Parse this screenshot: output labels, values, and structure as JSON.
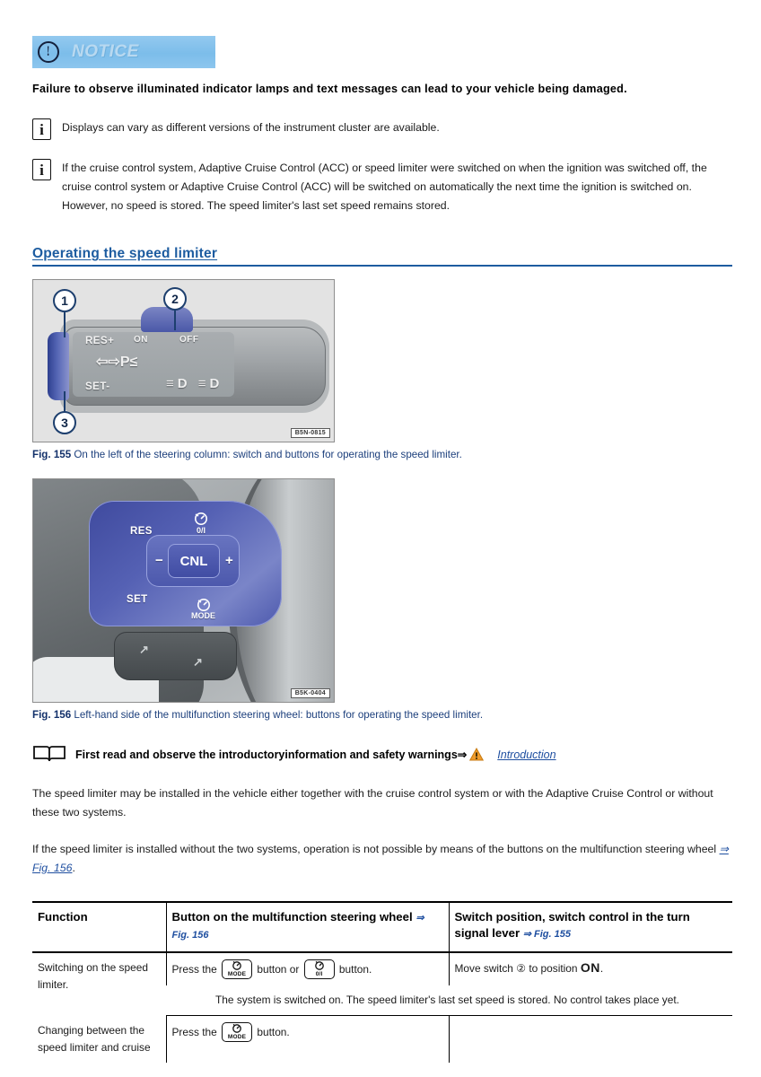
{
  "notice": {
    "icon": "exclamation-circle-icon",
    "label": "NOTICE",
    "text": "Failure to observe illuminated indicator lamps and text messages can lead to your vehicle being damaged."
  },
  "notes": [
    {
      "icon": "info-icon",
      "text": "Displays can vary as different versions of the instrument cluster are available."
    },
    {
      "icon": "info-icon",
      "text": "If the cruise control system, Adaptive Cruise Control (ACC) or speed limiter were switched on when the ignition was switched off, the cruise control system or Adaptive Cruise Control (ACC) will be switched on automatically the next time the ignition is switched on. However, no speed is stored. The speed limiter's last set speed remains stored."
    }
  ],
  "section": {
    "heading": "Operating the speed limiter"
  },
  "figures": [
    {
      "id": "fig-155",
      "code": "B5N-0815",
      "caption_label": "Fig. 155",
      "caption_text": "On the left of the steering column: switch and buttons for operating the speed limiter.",
      "callouts": [
        "1",
        "2",
        "3"
      ],
      "labels": {
        "res": "RES+",
        "on": "ON",
        "off": "OFF",
        "set": "SET-",
        "indicators": "⇦⇨P≤",
        "lamps": "≡D ≡D"
      }
    },
    {
      "id": "fig-156",
      "code": "B5K-0404",
      "caption_label": "Fig. 156",
      "caption_text": "Left-hand side of the multifunction steering wheel: buttons for operating the speed limiter.",
      "labels": {
        "res": "RES",
        "set": "SET",
        "cnl": "CNL",
        "minus": "−",
        "plus": "+",
        "on_off": "0/I",
        "mode": "MODE",
        "lower_left": "↗",
        "lower_right": "↗"
      }
    }
  ],
  "intro": {
    "icon": "open-book-icon",
    "bold_text": "First read and observe the introductoryinformation and safety warnings",
    "arrow": "⇒",
    "warning_icon": "warning-triangle-icon",
    "link": "Introduction"
  },
  "paragraphs": [
    {
      "text": "The speed limiter may be installed in the vehicle either together with the cruise control system or with the Adaptive Cruise Control or without these two systems."
    },
    {
      "text": "If the speed limiter is installed without the two systems, operation is not possible by means of the buttons on the multifunction steering wheel ",
      "xref": "⇒ Fig. 156",
      "tail": "."
    }
  ],
  "table": {
    "headers": [
      {
        "text": "Function",
        "ref": ""
      },
      {
        "text": "Button on the multifunction steering wheel",
        "ref": "⇒ Fig. 156"
      },
      {
        "text": "Switch position, switch control in the turn signal lever",
        "ref": "⇒ Fig. 155"
      }
    ],
    "rows": [
      {
        "function": "Switching on the speed limiter.",
        "button_prefix": "Press the",
        "button_icon_1": {
          "glyph": "speedometer-icon",
          "sub": "MODE"
        },
        "button_mid": "button or",
        "button_icon_2": {
          "glyph": "speedometer-icon",
          "sub": "0/I"
        },
        "button_suffix": "button.",
        "switch_prefix": "Move switch",
        "switch_callout": "②",
        "switch_mid": "to position",
        "switch_value": "ON",
        "switch_suffix": ".",
        "note": "The system is switched on. The speed limiter's last set speed is stored. No control takes place yet."
      },
      {
        "function": "Changing between the speed limiter and cruise",
        "button_prefix": "Press the",
        "button_icon_1": {
          "glyph": "speedometer-icon",
          "sub": "MODE"
        },
        "button_suffix": "button.",
        "switch_prefix": "",
        "note": ""
      }
    ]
  },
  "colors": {
    "accent_blue": "#1d5ca0",
    "link_blue": "#1f4fa0",
    "notice_bg": "#7cbdea",
    "warning_orange": "#e8902a"
  }
}
